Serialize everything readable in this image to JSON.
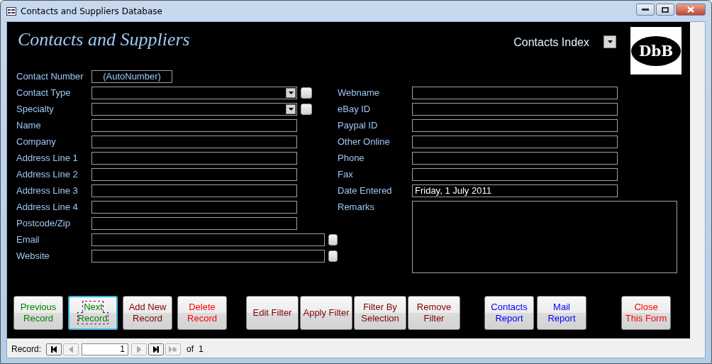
{
  "window": {
    "title": "Contacts and Suppliers Database"
  },
  "form": {
    "title": "Contacts and Suppliers",
    "index_label": "Contacts Index",
    "logo_text": "DbB"
  },
  "left_fields": [
    {
      "label": "Contact Number",
      "kind": "auto",
      "value": "(AutoNumber)"
    },
    {
      "label": "Contact Type",
      "kind": "combo",
      "has_button": true
    },
    {
      "label": "Specialty",
      "kind": "combo",
      "has_button": true
    },
    {
      "label": "Name",
      "kind": "text"
    },
    {
      "label": "Company",
      "kind": "text"
    },
    {
      "label": "Address Line 1",
      "kind": "text"
    },
    {
      "label": "Address Line 2",
      "kind": "text"
    },
    {
      "label": "Address Line 3",
      "kind": "text"
    },
    {
      "label": "Address Line 4",
      "kind": "text"
    },
    {
      "label": "Postcode/Zip",
      "kind": "text"
    },
    {
      "label": "Email",
      "kind": "long-text",
      "has_button": true
    },
    {
      "label": "Website",
      "kind": "long-text",
      "has_button": true
    }
  ],
  "right_fields": [
    {
      "label": "Webname",
      "kind": "text"
    },
    {
      "label": "eBay ID",
      "kind": "text"
    },
    {
      "label": "Paypal ID",
      "kind": "text"
    },
    {
      "label": "Other Online",
      "kind": "text"
    },
    {
      "label": "Phone",
      "kind": "text"
    },
    {
      "label": "Fax",
      "kind": "text"
    },
    {
      "label": "Date Entered",
      "kind": "text",
      "value": "Friday, 1 July 2011"
    },
    {
      "label": "Remarks",
      "kind": "memo"
    }
  ],
  "button_groups": [
    [
      {
        "label": "Previous\nRecord",
        "color": "#008000",
        "focused": false
      },
      {
        "label": "Next\nRecord",
        "color": "#008000",
        "focused": true
      },
      {
        "label": "Add New\nRecord",
        "color": "#800000",
        "focused": false
      },
      {
        "label": "Delete\nRecord",
        "color": "#ff0000",
        "focused": false
      }
    ],
    [
      {
        "label": "Edit Filter",
        "color": "#800000",
        "focused": false
      },
      {
        "label": "Apply Filter",
        "color": "#800000",
        "focused": false
      },
      {
        "label": "Filter By\nSelection",
        "color": "#800000",
        "focused": false
      },
      {
        "label": "Remove\nFilter",
        "color": "#800000",
        "focused": false
      }
    ],
    [
      {
        "label": "Contacts\nReport",
        "color": "#0000ff",
        "focused": false
      },
      {
        "label": "Mail\nReport",
        "color": "#0000ff",
        "focused": false
      }
    ],
    [
      {
        "label": "Close\nThis Form",
        "color": "#ff0000",
        "focused": false
      }
    ]
  ],
  "record_nav": {
    "label": "Record:",
    "current": "1",
    "of_label": "of",
    "total": "1",
    "buttons": [
      {
        "kind": "first",
        "disabled": false
      },
      {
        "kind": "previous",
        "disabled": true
      },
      {
        "kind": "next",
        "disabled": true
      },
      {
        "kind": "last",
        "disabled": false
      },
      {
        "kind": "new",
        "disabled": true
      }
    ]
  }
}
